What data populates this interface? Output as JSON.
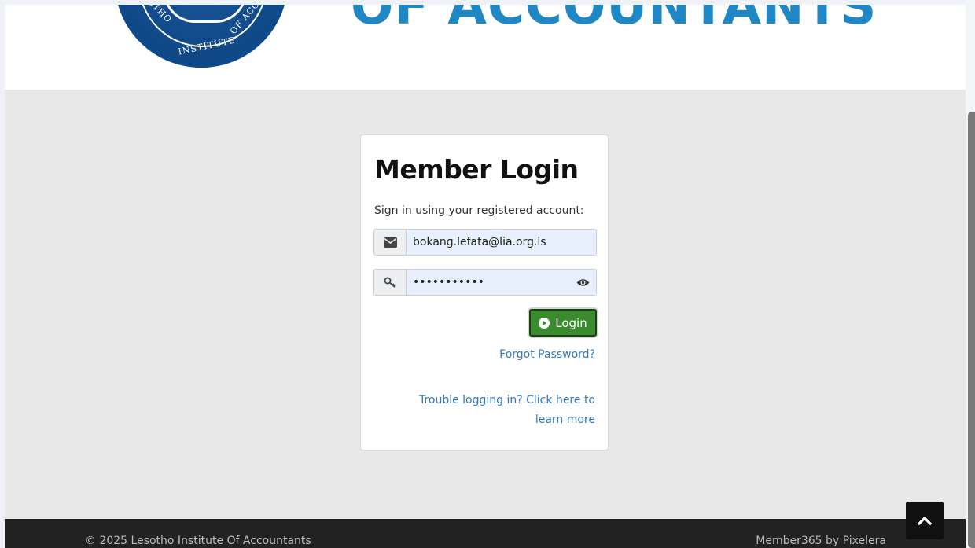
{
  "header": {
    "logo_name": "lesotho-institute-of-accountants-logo",
    "seal_text": [
      "SOTHO",
      "INSTITUTE",
      "OF ACC"
    ],
    "wordmark": "OF ACCOUNTANTS"
  },
  "login": {
    "title": "Member Login",
    "subtitle": "Sign in using your registered account:",
    "email_value": "bokang.lefata@lia.org.ls",
    "email_icon": "envelope-icon",
    "password_value": "•••••••••••",
    "password_icon": "key-icon",
    "password_toggle_icon": "eye-icon",
    "login_label": "Login",
    "login_icon": "play-circle-icon",
    "forgot_label": "Forgot Password?",
    "trouble_label": "Trouble logging in? Click here to learn more"
  },
  "footer": {
    "copyright": "© 2025 Lesotho Institute Of Accountants",
    "credit": "Member365 by Pixelera",
    "back_to_top_icon": "chevron-up-icon"
  },
  "colors": {
    "brand_blue": "#1f87c4",
    "seal_blue": "#114a8a",
    "login_green": "#3a8a2e",
    "link_blue": "#3478b8",
    "footer_bg": "#222222",
    "page_bg": "#e8e8e8",
    "autofill_bg": "#e8f0fe"
  }
}
